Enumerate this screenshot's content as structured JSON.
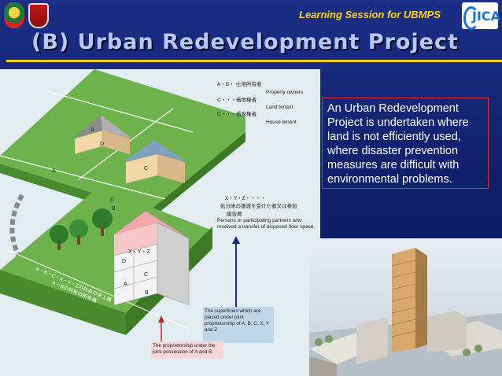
{
  "header": {
    "session_text": "Learning Session for UBMPS",
    "jica_logo_text": "JICA"
  },
  "slide": {
    "title": "(B) Urban Redevelopment Project",
    "description": "An Urban Redevelopment Project is undertaken where land is not efficiently used, where disaster prevention measures are difficult with environmental problems."
  },
  "diagram": {
    "legend_top": [
      {
        "code": "A・B・・",
        "jp": "土地所有者",
        "en": "Property owners"
      },
      {
        "code": "C・・・・",
        "jp": "借地権者",
        "en": "Land tenant"
      },
      {
        "code": "D・・・・",
        "jp": "借家権者",
        "en": "House tenant"
      }
    ],
    "legend_mid": {
      "code": "X・Y・Z・・・・",
      "jp_line1": "処分床の譲渡を受けた者又は参加",
      "jp_line2": "組合員",
      "en": "Persons or participating partners who received a transfer of disposed floor space."
    },
    "lot_labels": [
      "A",
      "B",
      "C",
      "D"
    ],
    "before_labels": {
      "A": "A",
      "B": "B",
      "C": "C",
      "D": "D"
    },
    "after_labels": {
      "xyz": "X・Y・Z",
      "d": "D",
      "c": "C",
      "a": "A",
      "b": "B"
    },
    "slab_text_1": "A・B・C・X・Y・Zの共有の床上権",
    "slab_text_2": "A・Bの共有の所有権",
    "note_superficies": "The superficies which are placed under joint proprietorship of A, B, C, X, Y and Z",
    "note_proprietorship": "The proprietorship under the joint possession of A and B."
  }
}
